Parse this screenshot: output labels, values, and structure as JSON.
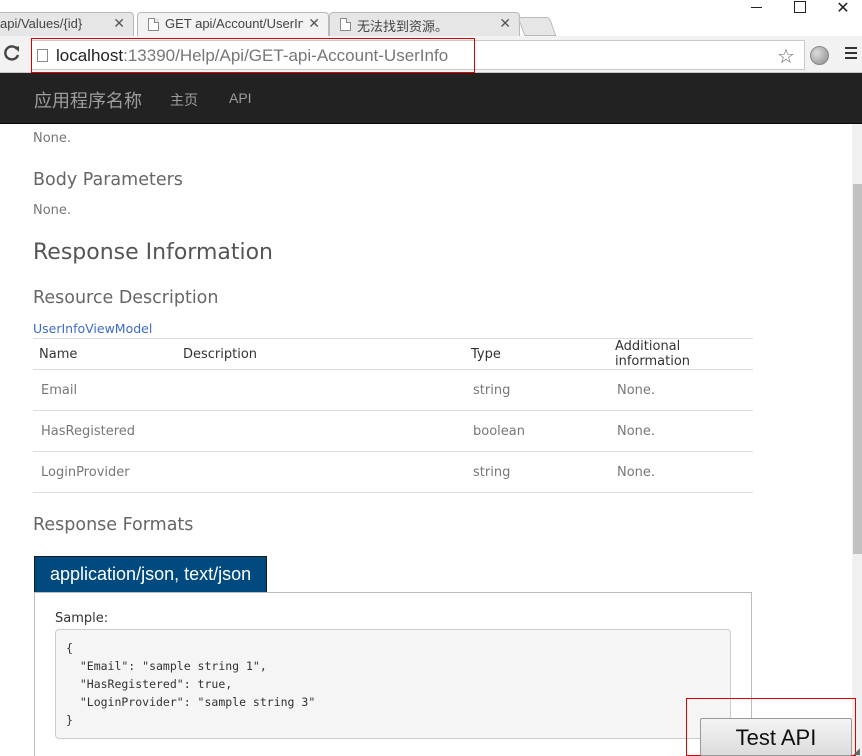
{
  "browser": {
    "tabs": [
      {
        "title": "api/Values/{id}"
      },
      {
        "title": "GET api/Account/UserIn"
      },
      {
        "title": "无法找到资源。"
      }
    ],
    "url_host": "localhost",
    "url_rest": ":13390/Help/Api/GET-api-Account-UserInfo"
  },
  "navbar": {
    "brand": "应用程序名称",
    "links": [
      "主页",
      "API"
    ]
  },
  "page": {
    "uri_params_none": "None.",
    "body_params_heading": "Body Parameters",
    "body_params_none": "None.",
    "response_info_heading": "Response Information",
    "resource_desc_heading": "Resource Description",
    "model_link": "UserInfoViewModel",
    "table": {
      "headers": [
        "Name",
        "Description",
        "Type",
        "Additional information"
      ],
      "rows": [
        {
          "name": "Email",
          "description": "",
          "type": "string",
          "info": "None."
        },
        {
          "name": "HasRegistered",
          "description": "",
          "type": "boolean",
          "info": "None."
        },
        {
          "name": "LoginProvider",
          "description": "",
          "type": "string",
          "info": "None."
        }
      ]
    },
    "response_formats_heading": "Response Formats",
    "format_tab": "application/json, text/json",
    "sample_label": "Sample:",
    "sample_body": "{\n  \"Email\": \"sample string 1\",\n  \"HasRegistered\": true,\n  \"LoginProvider\": \"sample string 3\"\n}"
  },
  "test_api_button": "Test API",
  "colors": {
    "navbar_bg": "#222222",
    "format_tab_bg": "#004a80",
    "link": "#3b6bcb",
    "highlight": "#e00000"
  }
}
